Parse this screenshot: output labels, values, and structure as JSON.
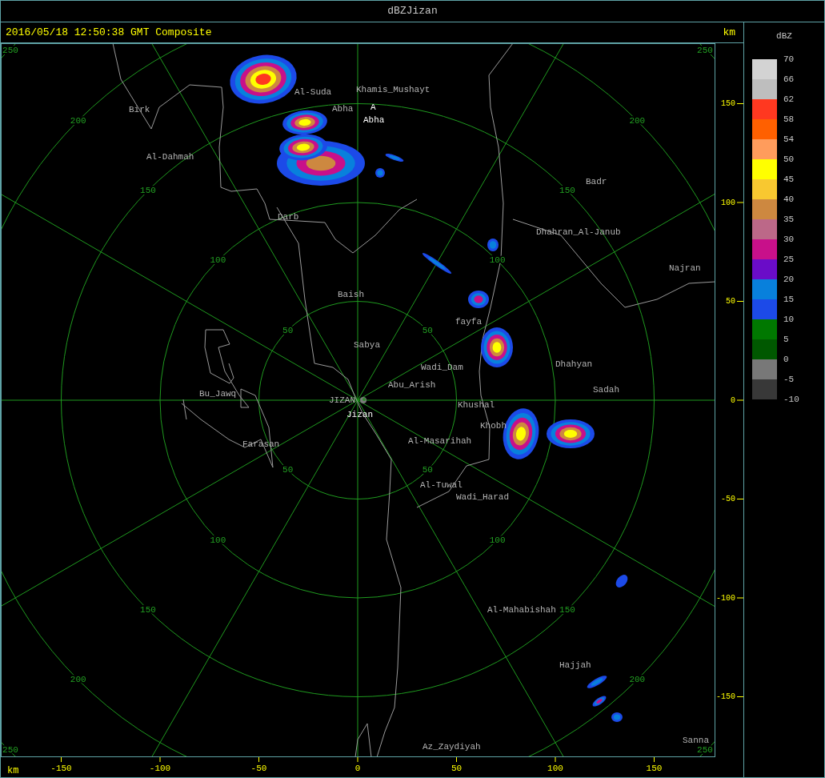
{
  "window": {
    "title": "dBZJizan"
  },
  "header": {
    "timestamp": "2016/05/18 12:50:38 GMT Composite",
    "unit": "km"
  },
  "map": {
    "range_rings": [
      {
        "labels": [
          "50",
          "50",
          "50",
          "50"
        ]
      },
      {
        "labels": [
          "100",
          "100",
          "100",
          "100"
        ]
      },
      {
        "labels": [
          "150",
          "150",
          "150",
          "150"
        ]
      },
      {
        "labels": [
          "200",
          "200",
          "200",
          "200"
        ]
      },
      {
        "labels": [
          "250",
          "250",
          "250",
          "250"
        ]
      }
    ],
    "places": [
      {
        "name": "Al-Suda",
        "kind": "city"
      },
      {
        "name": "Khamis_Mushayt",
        "kind": "city"
      },
      {
        "name": "Abha",
        "kind": "city"
      },
      {
        "name": "A",
        "kind": "station"
      },
      {
        "name": "Abha",
        "kind": "station"
      },
      {
        "name": "Birk",
        "kind": "city"
      },
      {
        "name": "Al-Dahmah",
        "kind": "city"
      },
      {
        "name": "Badr",
        "kind": "city"
      },
      {
        "name": "Darb",
        "kind": "city"
      },
      {
        "name": "Dhahran_Al-Janub",
        "kind": "city"
      },
      {
        "name": "Najran",
        "kind": "city"
      },
      {
        "name": "Baish",
        "kind": "city"
      },
      {
        "name": "fayfa",
        "kind": "city"
      },
      {
        "name": "Sabya",
        "kind": "city"
      },
      {
        "name": "Wadi_Dam",
        "kind": "city"
      },
      {
        "name": "Dhahyan",
        "kind": "city"
      },
      {
        "name": "Abu_Arish",
        "kind": "city"
      },
      {
        "name": "Sadah",
        "kind": "city"
      },
      {
        "name": "Bu_Jawq",
        "kind": "city"
      },
      {
        "name": "JIZAN",
        "kind": "city"
      },
      {
        "name": "Jizan",
        "kind": "station"
      },
      {
        "name": "Khushal",
        "kind": "city"
      },
      {
        "name": "Khobh",
        "kind": "city"
      },
      {
        "name": "Al-Masarihah",
        "kind": "city"
      },
      {
        "name": "Farasan",
        "kind": "city"
      },
      {
        "name": "Al-Tuwal",
        "kind": "city"
      },
      {
        "name": "Wadi_Harad",
        "kind": "city"
      },
      {
        "name": "Al-Mahabishah",
        "kind": "city"
      },
      {
        "name": "Hajjah",
        "kind": "city"
      },
      {
        "name": "Az_Zaydiyah",
        "kind": "city"
      },
      {
        "name": "Sanna",
        "kind": "city"
      }
    ]
  },
  "y_axis": {
    "ticks": [
      "150",
      "100",
      "50",
      "0",
      "-50",
      "-100",
      "-150"
    ]
  },
  "x_axis": {
    "unit": "km",
    "ticks": [
      "-150",
      "-100",
      "-50",
      "0",
      "50",
      "100",
      "150"
    ]
  },
  "legend": {
    "title": "dBZ",
    "levels": [
      "70",
      "66",
      "62",
      "58",
      "54",
      "50",
      "45",
      "40",
      "35",
      "30",
      "25",
      "20",
      "15",
      "10",
      "5",
      "0",
      "-5",
      "-10"
    ],
    "bands": [
      {
        "color": "#d3d3d3"
      },
      {
        "color": "#bebebe"
      },
      {
        "color": "#ff3820"
      },
      {
        "color": "#ff6000"
      },
      {
        "color": "#ff9c5c"
      },
      {
        "color": "#ffff00"
      },
      {
        "color": "#f8c830"
      },
      {
        "color": "#cd8840"
      },
      {
        "color": "#bc6888"
      },
      {
        "color": "#c8108a"
      },
      {
        "color": "#6a0cc8"
      },
      {
        "color": "#0880dc"
      },
      {
        "color": "#1c4ae8"
      },
      {
        "color": "#007800"
      },
      {
        "color": "#005800"
      },
      {
        "color": "#787878"
      },
      {
        "color": "#383838"
      }
    ]
  }
}
